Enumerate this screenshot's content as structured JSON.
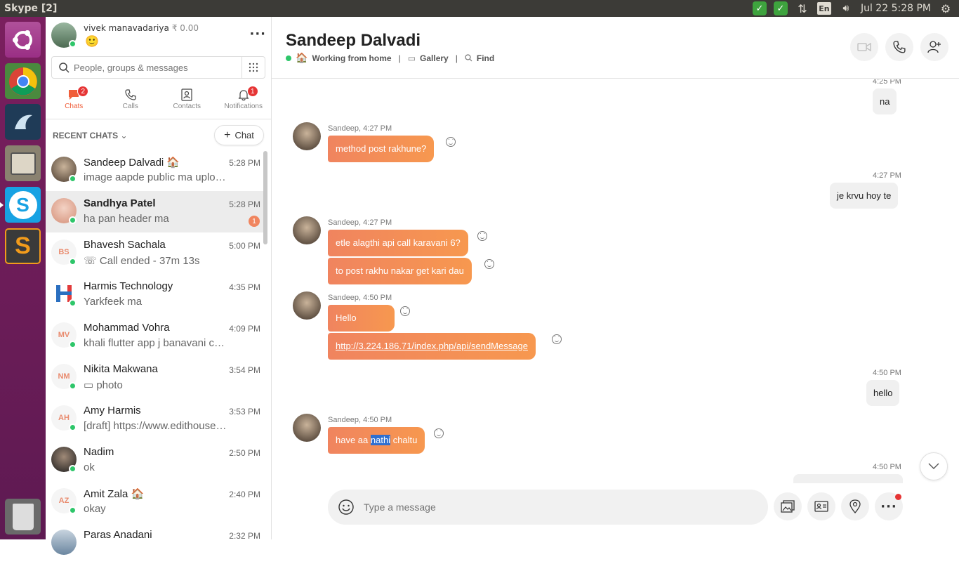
{
  "window": {
    "title": "Skype [2]"
  },
  "system": {
    "clock": "Jul 22  5:28 PM",
    "keyboard": "En"
  },
  "profile": {
    "name": "vivek manavadariya",
    "credit": "₹ 0.00",
    "mood": "🙂"
  },
  "search": {
    "placeholder": "People, groups & messages"
  },
  "nav": {
    "chats": {
      "label": "Chats",
      "badge": "2"
    },
    "calls": {
      "label": "Calls"
    },
    "contacts": {
      "label": "Contacts"
    },
    "notifications": {
      "label": "Notifications",
      "badge": "1"
    }
  },
  "recent_label": "RECENT CHATS",
  "new_chat_label": "Chat",
  "chats": [
    {
      "name": "Sandeep Dalvadi 🏠",
      "preview": "image aapde public ma uploa...",
      "time": "5:28 PM",
      "initials": "",
      "avatar_color": "#6b5a4a"
    },
    {
      "name": "Sandhya Patel",
      "preview": "ha pan header ma",
      "time": "5:28 PM",
      "initials": "",
      "badge": "1",
      "avatar_color": "#e7b9a6"
    },
    {
      "name": "Bhavesh Sachala",
      "preview": "☏ Call ended - 37m 13s",
      "time": "5:00 PM",
      "initials": "BS"
    },
    {
      "name": "Harmis Technology",
      "preview": "Yarkfeek ma",
      "time": "4:35 PM",
      "initials": ""
    },
    {
      "name": "Mohammad Vohra",
      "preview": "khali flutter app j banavani ch...",
      "time": "4:09 PM",
      "initials": "MV"
    },
    {
      "name": "Nikita Makwana",
      "preview": "▭ photo",
      "time": "3:54 PM",
      "initials": "NM"
    },
    {
      "name": "Amy Harmis",
      "preview": "[draft] https://www.edithouse....",
      "time": "3:53 PM",
      "initials": "AH"
    },
    {
      "name": "Nadim",
      "preview": "ok",
      "time": "2:50 PM",
      "initials": "",
      "avatar_color": "#2a2a2a"
    },
    {
      "name": "Amit Zala 🏠",
      "preview": "okay",
      "time": "2:40 PM",
      "initials": "AZ"
    },
    {
      "name": "Paras Anadani",
      "preview": "",
      "time": "2:32 PM",
      "initials": "",
      "avatar_color": "#8aa0b8"
    }
  ],
  "conversation": {
    "name": "Sandeep Dalvadi",
    "status": "Working from home",
    "gallery": "Gallery",
    "find": "Find",
    "messages": {
      "t1": "4:25 PM",
      "o1": "na",
      "s1": "Sandeep, 4:27 PM",
      "i1": "method post rakhune?",
      "t2": "4:27 PM",
      "o2": "je krvu hoy te",
      "s2": "Sandeep, 4:27 PM",
      "i2": "etle alagthi api call karavani 6?",
      "i3": "to post rakhu nakar get kari dau",
      "s3": "Sandeep, 4:50 PM",
      "i4": "Hello",
      "i5": "http://3.224.186.71/index.php/api/sendMessage",
      "t3": "4:50 PM",
      "o3": "hello",
      "s4": "Sandeep, 4:50 PM",
      "i6a": "have aa ",
      "i6b": "nathi",
      "i6c": " chaltu",
      "t4": "4:50 PM"
    },
    "composer_placeholder": "Type a message"
  }
}
